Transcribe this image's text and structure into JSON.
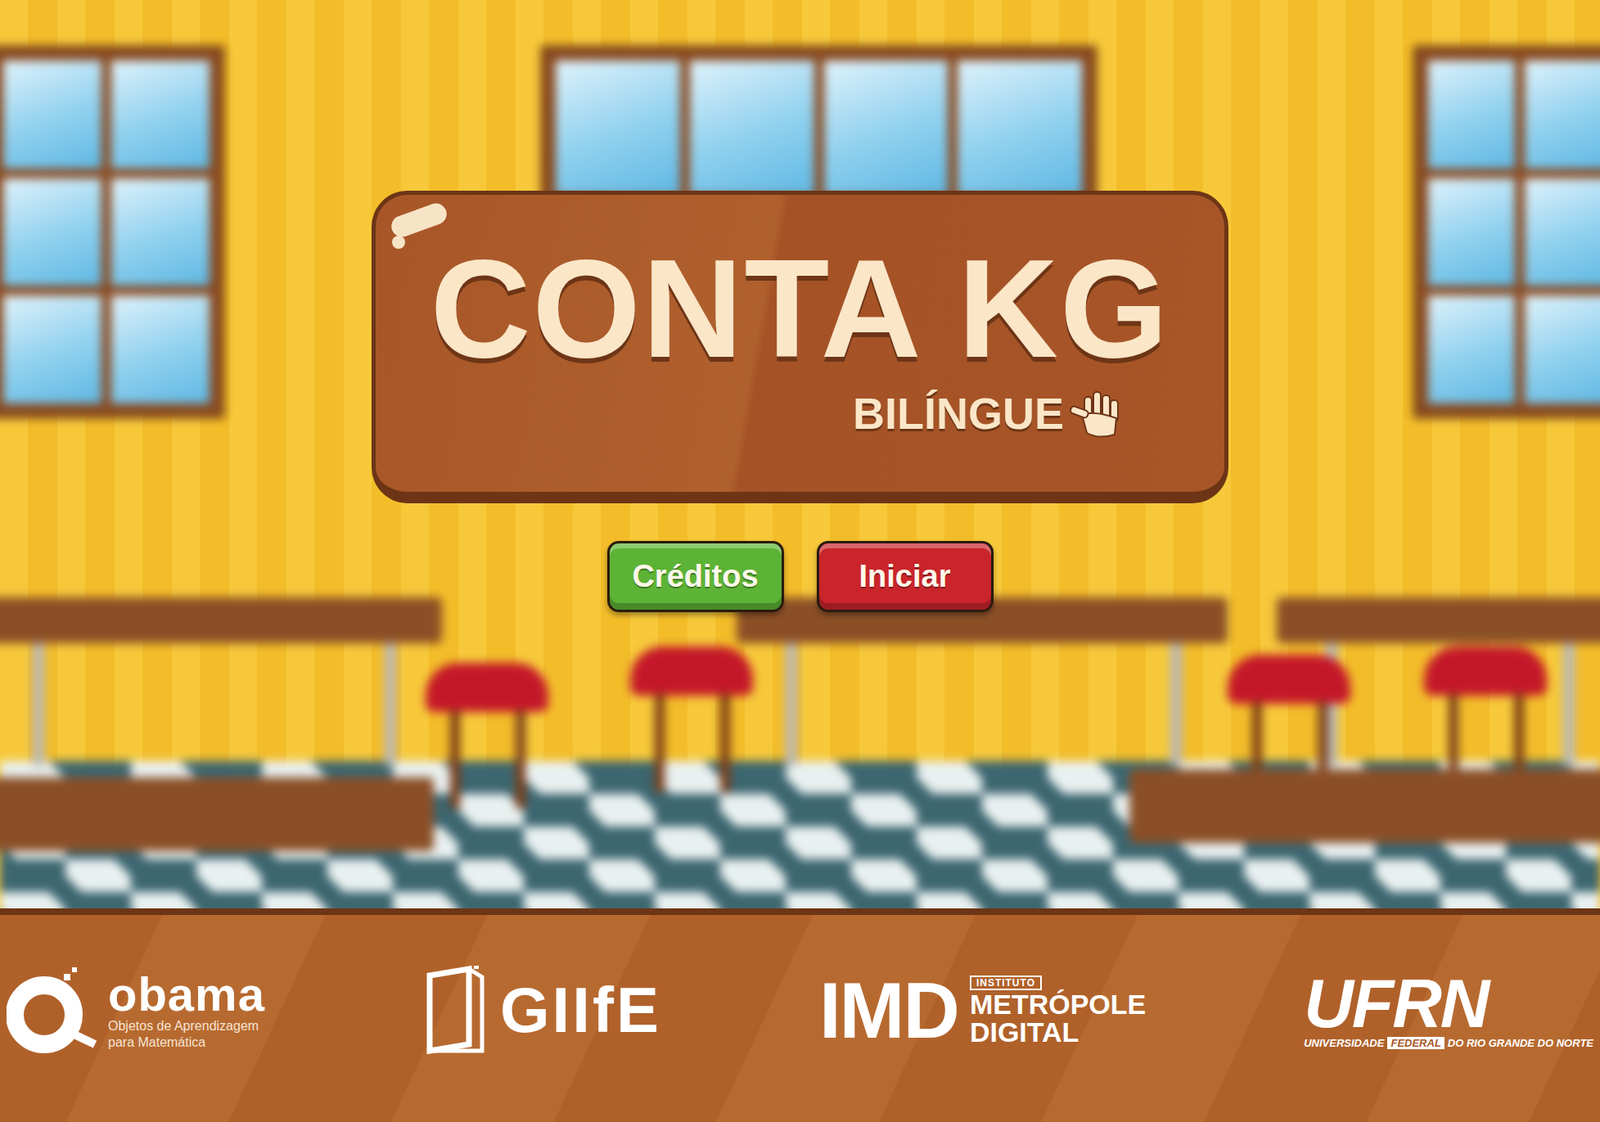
{
  "title": {
    "main": "CONTA KG",
    "sub": "BILÍNGUE"
  },
  "buttons": [
    {
      "label": "Créditos",
      "color": "#5cb335"
    },
    {
      "label": "Iniciar",
      "color": "#c9252b"
    }
  ],
  "footer": {
    "logos": [
      {
        "kind": "obama",
        "name": "obama",
        "caption": [
          "Objetos de Aprendizagem",
          "para Matemática"
        ]
      },
      {
        "kind": "giife",
        "name": "GIIfE"
      },
      {
        "kind": "imd",
        "name": "IMD",
        "tag": "INSTITUTO",
        "lines": [
          "METRÓPOLE",
          "DIGITAL"
        ]
      },
      {
        "kind": "ufrn",
        "name": "UFRN",
        "caption": [
          "UNIVERSIDADE",
          "FEDERAL",
          "DO RIO GRANDE DO NORTE"
        ]
      }
    ]
  }
}
